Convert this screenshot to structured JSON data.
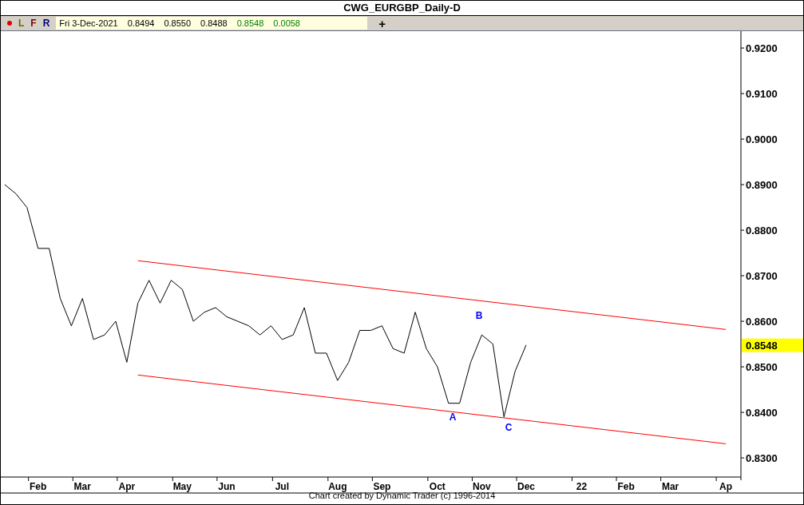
{
  "title": "CWG_EURGBP_Daily-D",
  "toolbar": {
    "dot": {
      "color": "#e00000"
    },
    "letters": [
      {
        "text": "L",
        "color": "#6b6b00"
      },
      {
        "text": "F",
        "color": "#800000"
      },
      {
        "text": "R",
        "color": "#000080"
      }
    ],
    "quote": [
      {
        "text": "Fri 3-Dec-2021",
        "kind": "plain"
      },
      {
        "text": "0.8494",
        "kind": "plain"
      },
      {
        "text": "0.8550",
        "kind": "plain"
      },
      {
        "text": "0.8488",
        "kind": "plain"
      },
      {
        "text": "0.8548",
        "kind": "gain"
      },
      {
        "text": "0.0058",
        "kind": "gain"
      }
    ],
    "plus": "+"
  },
  "chart_data": {
    "type": "line",
    "categories": [
      null,
      null,
      null,
      "Feb",
      null,
      null,
      null,
      "Mar",
      null,
      null,
      null,
      "Apr",
      null,
      null,
      null,
      null,
      "May",
      null,
      null,
      null,
      "Jun",
      null,
      null,
      null,
      null,
      "Jul",
      null,
      null,
      null,
      null,
      "Aug",
      null,
      null,
      null,
      "Sep",
      null,
      null,
      null,
      null,
      "Oct",
      null,
      null,
      null,
      "Nov",
      null,
      null,
      null,
      "Dec",
      null,
      null,
      null,
      null,
      "22",
      null,
      null,
      null,
      "Feb",
      null,
      null,
      null,
      "Mar",
      null,
      null,
      null,
      null,
      "Ap"
    ],
    "series": [
      {
        "color": "#000000",
        "values": [
          0.89,
          0.888,
          0.885,
          0.876,
          0.876,
          0.865,
          0.859,
          0.865,
          0.856,
          0.857,
          0.86,
          0.851,
          0.864,
          0.869,
          0.864,
          0.869,
          0.867,
          0.86,
          0.862,
          0.863,
          0.861,
          0.86,
          0.859,
          0.857,
          0.859,
          0.856,
          0.857,
          0.863,
          0.853,
          0.853,
          0.847,
          0.851,
          0.858,
          0.858,
          0.859,
          0.854,
          0.853,
          0.862,
          0.854,
          0.85,
          0.842,
          0.842,
          0.851,
          0.857,
          0.855,
          0.839,
          0.849,
          0.8548,
          null,
          null,
          null,
          null,
          null,
          null,
          null,
          null,
          null,
          null,
          null,
          null,
          null,
          null,
          null,
          null,
          null,
          null
        ]
      },
      {
        "color": "#ff0000",
        "values": [
          null,
          null,
          null,
          null,
          null,
          null,
          null,
          null,
          null,
          null,
          null,
          null,
          0.8733,
          null,
          null,
          null,
          null,
          null,
          null,
          null,
          null,
          null,
          null,
          null,
          null,
          null,
          null,
          null,
          null,
          null,
          null,
          null,
          null,
          null,
          null,
          null,
          null,
          null,
          null,
          null,
          null,
          null,
          null,
          null,
          null,
          null,
          null,
          null,
          null,
          null,
          null,
          null,
          null,
          null,
          null,
          null,
          null,
          null,
          null,
          null,
          null,
          null,
          null,
          null,
          null,
          0.8582
        ]
      },
      {
        "color": "#ff0000",
        "values": [
          null,
          null,
          null,
          null,
          null,
          null,
          null,
          null,
          null,
          null,
          null,
          null,
          0.8482,
          null,
          null,
          null,
          null,
          null,
          null,
          null,
          null,
          null,
          null,
          null,
          null,
          null,
          null,
          null,
          null,
          null,
          null,
          null,
          null,
          null,
          null,
          null,
          null,
          null,
          null,
          null,
          null,
          null,
          null,
          null,
          null,
          null,
          null,
          null,
          null,
          null,
          null,
          null,
          null,
          null,
          null,
          null,
          null,
          null,
          null,
          null,
          null,
          null,
          null,
          null,
          null,
          0.8331
        ]
      }
    ],
    "ylim": [
      0.8258,
      0.9237
    ],
    "yticks": [
      {
        "value": 0.92,
        "label": "0.9200"
      },
      {
        "value": 0.91,
        "label": "0.9100"
      },
      {
        "value": 0.9,
        "label": "0.9000"
      },
      {
        "value": 0.89,
        "label": "0.8900"
      },
      {
        "value": 0.88,
        "label": "0.8800"
      },
      {
        "value": 0.87,
        "label": "0.8700"
      },
      {
        "value": 0.86,
        "label": "0.8600"
      },
      {
        "value": 0.85,
        "label": "0.8500"
      },
      {
        "value": 0.84,
        "label": "0.8400"
      },
      {
        "value": 0.83,
        "label": "0.8300"
      }
    ],
    "annotations": [
      "A",
      "B",
      "C"
    ]
  },
  "price_marker": {
    "text": "0.8548"
  },
  "footer": "Chart created by Dynamic Trader  (c) 1996-2014"
}
